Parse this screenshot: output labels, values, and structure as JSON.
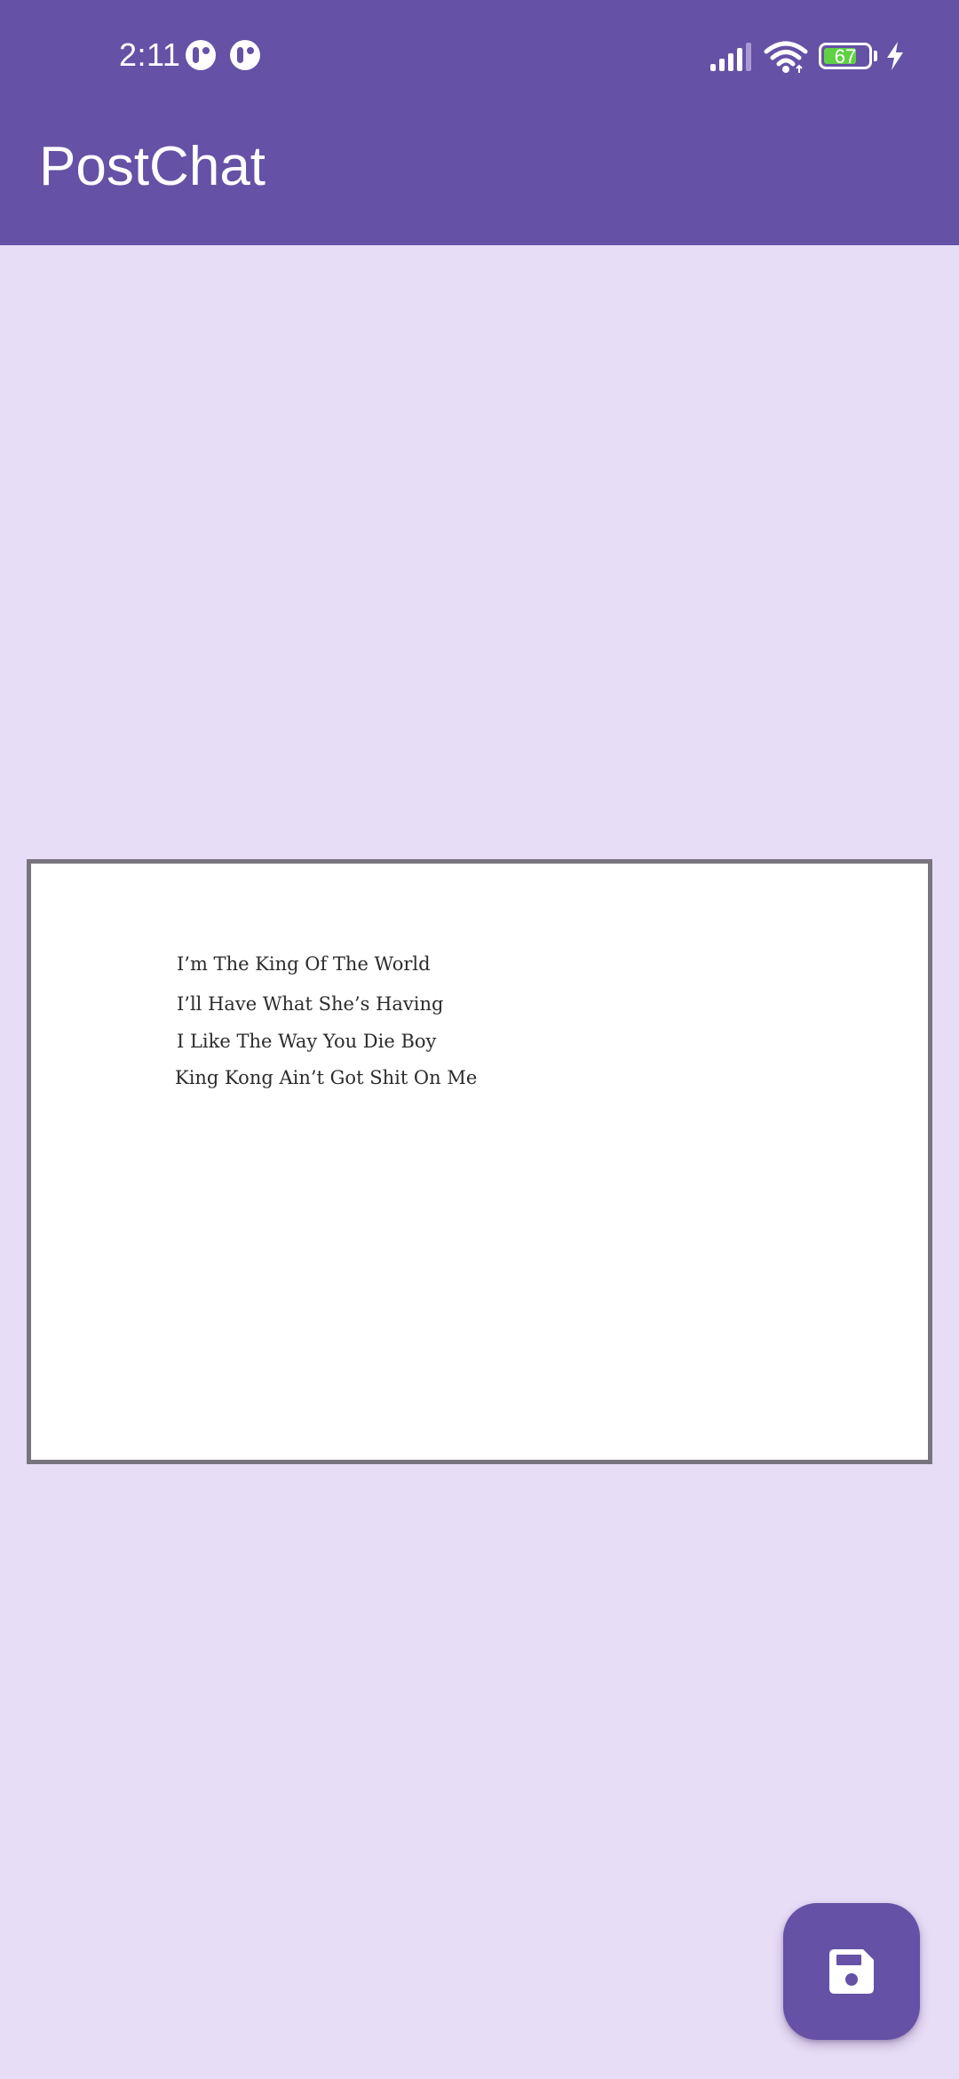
{
  "status_bar": {
    "time": "2:11",
    "battery_level": "67",
    "battery_color": "#5fd145",
    "icons": [
      "notification-app-icon",
      "notification-app-icon",
      "signal-icon",
      "wifi-icon",
      "battery-icon",
      "charging-bolt-icon"
    ]
  },
  "app_bar": {
    "title": "PostChat",
    "color": "#6551a6"
  },
  "canvas": {
    "lines": [
      "I’m The King Of The World",
      "I’ll Have What She’s Having",
      "I Like The Way You Die Boy",
      "King Kong Ain’t Got Shit On Me"
    ]
  },
  "fab": {
    "icon": "save-icon"
  },
  "colors": {
    "background": "#e7ddf7",
    "primary": "#6551a6",
    "card_border": "#79757f"
  }
}
